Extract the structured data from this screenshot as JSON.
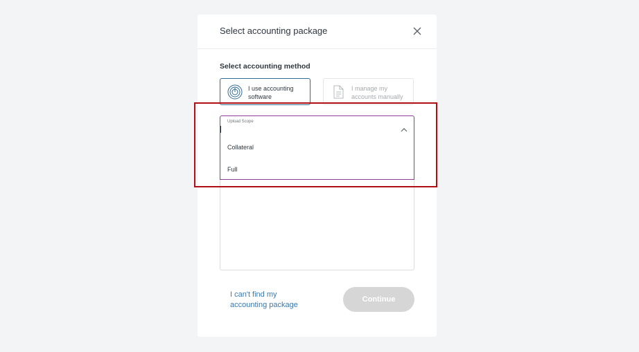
{
  "modal": {
    "title": "Select accounting package",
    "close_icon": "close-icon"
  },
  "method": {
    "section_label": "Select accounting method",
    "options": [
      {
        "label": "I use accounting software",
        "icon": "software-disc-icon",
        "selected": true
      },
      {
        "label": "I manage my accounts manually",
        "icon": "document-icon",
        "selected": false
      }
    ]
  },
  "upload_scope": {
    "label": "Upload Scope",
    "chevron_icon": "chevron-up-icon",
    "options": [
      "Collateral",
      "Full"
    ]
  },
  "footer": {
    "cant_find_link": "I can't find my accounting package",
    "continue_label": "Continue"
  },
  "colors": {
    "accent_purple": "#8e3b97",
    "selected_border": "#2f6a93",
    "link": "#3a78ad",
    "disabled_button": "#d6d6d6",
    "highlight": "#b00d15"
  }
}
